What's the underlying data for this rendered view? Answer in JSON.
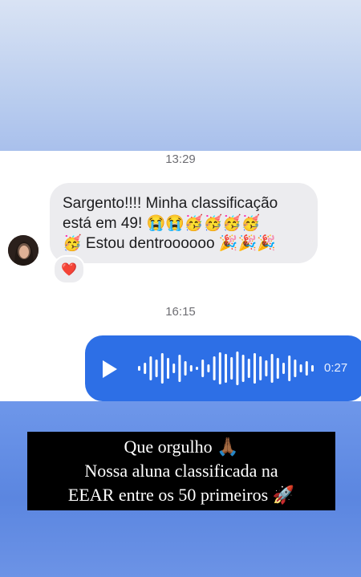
{
  "chat": {
    "timestamp_1": "13:29",
    "incoming_message": {
      "line1": "Sargento!!!! Minha classificação",
      "line2": "está em 49! 😭😭🥳🥳🥳🥳",
      "line3": "🥳 Estou dentroooooo 🎉🎉🎉"
    },
    "reaction": "❤️",
    "timestamp_2": "16:15",
    "voice_message": {
      "duration": "0:27"
    }
  },
  "caption": {
    "line1": "Que orgulho 🙏🏾",
    "line2": "Nossa aluna classificada na",
    "line3": "EEAR entre os 50 primeiros 🚀"
  },
  "colors": {
    "outgoing_bubble": "#2d6fe6",
    "incoming_bubble": "#ececef",
    "caption_bg": "#000000"
  }
}
